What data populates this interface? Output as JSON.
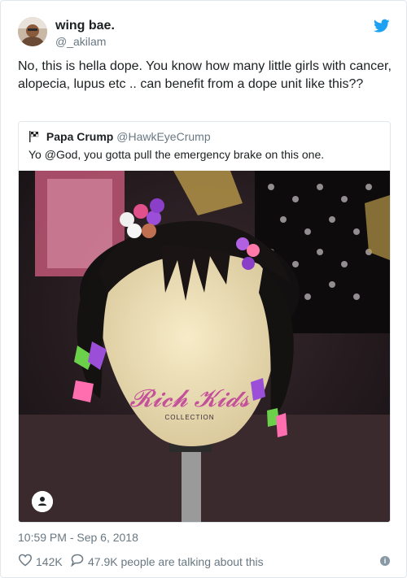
{
  "author": {
    "display_name": "wing bae.",
    "handle": "@_akilam"
  },
  "tweet": {
    "text": "No, this is hella dope. You know how many little girls with cancer, alopecia, lupus etc .. can benefit from a dope unit like this??"
  },
  "quoted": {
    "display_name": "Papa Crump",
    "handle": "@HawkEyeCrump",
    "text": "Yo @God, you gotta pull the emergency brake on this one.",
    "media": {
      "logo_text": "Rich Kids",
      "logo_subtext": "COLLECTION"
    }
  },
  "timestamp": "10:59 PM - Sep 6, 2018",
  "actions": {
    "likes": "142K",
    "conversation": "47.9K people are talking about this",
    "info_glyph": "i"
  },
  "icons": {
    "bird": "twitter-bird-icon",
    "flag": "checkered-flag-icon",
    "heart": "heart-icon",
    "reply": "speech-bubble-icon",
    "info": "info-icon",
    "user": "user-icon"
  },
  "colors": {
    "brand": "#1da1f2",
    "text": "#1c2022",
    "muted": "#697882",
    "border": "#e1e8ed"
  }
}
